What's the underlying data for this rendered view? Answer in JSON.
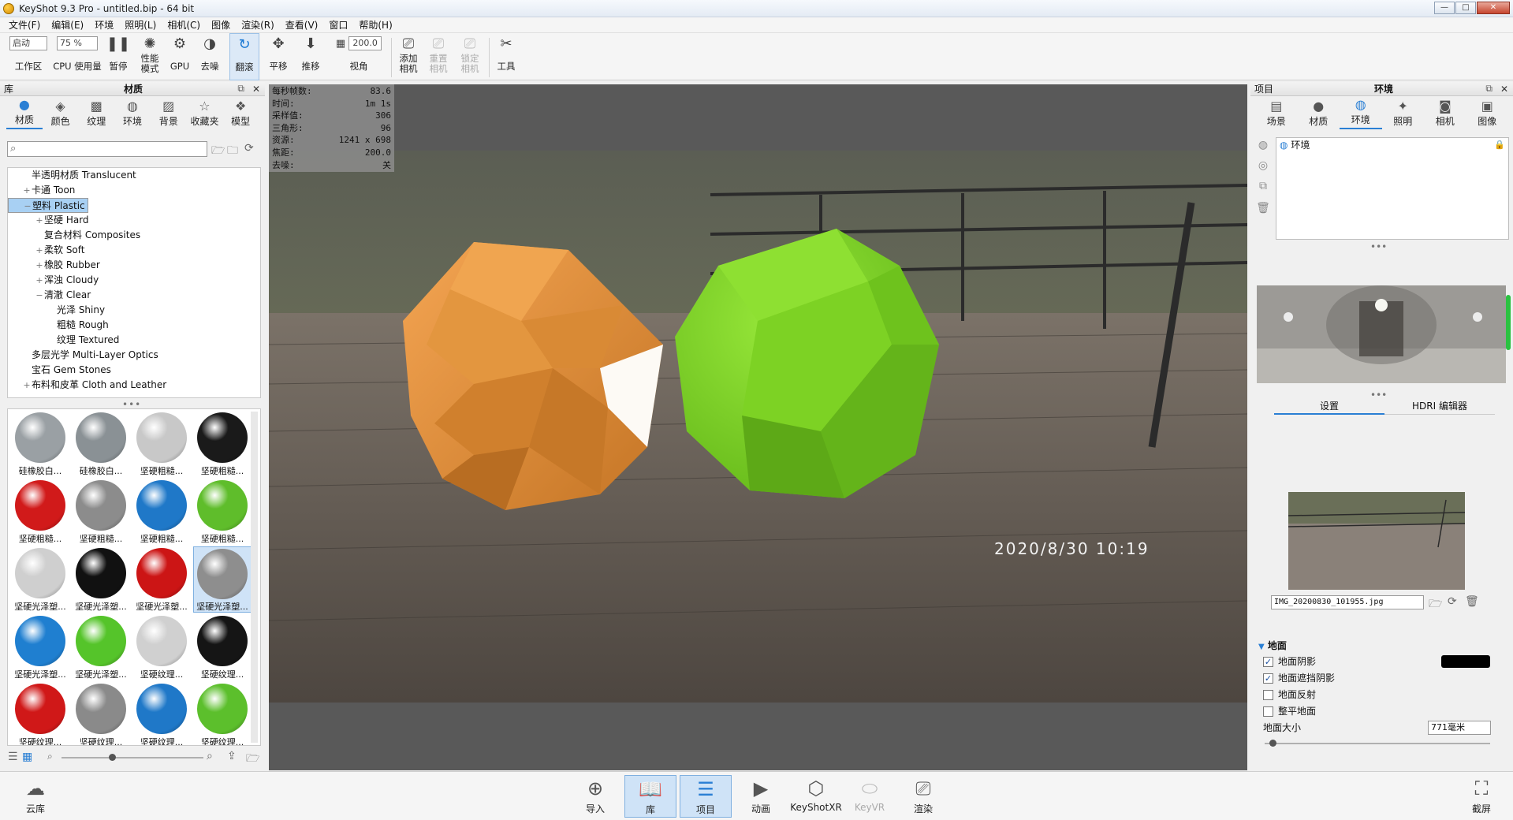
{
  "window": {
    "title": "KeyShot 9.3 Pro  - untitled.bip  - 64 bit",
    "min": "—",
    "max": "□",
    "close": "✕"
  },
  "menu": [
    "文件(F)",
    "编辑(E)",
    "环境",
    "照明(L)",
    "相机(C)",
    "图像",
    "渲染(R)",
    "查看(V)",
    "窗口",
    "帮助(H)"
  ],
  "toolbar": {
    "workspace_select": "启动",
    "workspace_label": "工作区",
    "cpu_select": "75 %",
    "cpu_label": "CPU 使用量",
    "pause_label": "暂停",
    "perf_label1": "性能",
    "perf_label2": "模式",
    "gpu_label": "GPU",
    "denoise_label": "去噪",
    "tumble_label": "翻滚",
    "pan_label": "平移",
    "dolly_label": "推移",
    "fov_value": "200.0",
    "fov_label": "视角",
    "add_cam_label1": "添加",
    "add_cam_label2": "相机",
    "reset_cam_label1": "重置",
    "reset_cam_label2": "相机",
    "lock_cam_label1": "锁定",
    "lock_cam_label2": "相机",
    "tools_label": "工具"
  },
  "library": {
    "header_left": "库",
    "header_title": "材质",
    "tabs": [
      {
        "icon": "material-icon",
        "label": "材质"
      },
      {
        "icon": "color-icon",
        "label": "颜色"
      },
      {
        "icon": "texture-icon",
        "label": "纹理"
      },
      {
        "icon": "environment-icon",
        "label": "环境"
      },
      {
        "icon": "background-icon",
        "label": "背景"
      },
      {
        "icon": "favorites-icon",
        "label": "收藏夹"
      },
      {
        "icon": "model-icon",
        "label": "模型"
      }
    ],
    "search_placeholder": "",
    "tree": [
      {
        "indent": 0,
        "exp": "",
        "label": "半透明材质 Translucent",
        "selected": false
      },
      {
        "indent": 0,
        "exp": "+",
        "label": "卡通 Toon",
        "selected": false
      },
      {
        "indent": 0,
        "exp": "−",
        "label": "塑料 Plastic",
        "selected": true
      },
      {
        "indent": 1,
        "exp": "+",
        "label": "坚硬 Hard",
        "selected": false
      },
      {
        "indent": 1,
        "exp": "",
        "label": "复合材料 Composites",
        "selected": false
      },
      {
        "indent": 1,
        "exp": "+",
        "label": "柔软 Soft",
        "selected": false
      },
      {
        "indent": 1,
        "exp": "+",
        "label": "橡胶 Rubber",
        "selected": false
      },
      {
        "indent": 1,
        "exp": "+",
        "label": "浑浊 Cloudy",
        "selected": false
      },
      {
        "indent": 1,
        "exp": "−",
        "label": "清澈 Clear",
        "selected": false
      },
      {
        "indent": 2,
        "exp": "",
        "label": "光泽 Shiny",
        "selected": false
      },
      {
        "indent": 2,
        "exp": "",
        "label": "粗糙 Rough",
        "selected": false
      },
      {
        "indent": 2,
        "exp": "",
        "label": "纹理 Textured",
        "selected": false
      },
      {
        "indent": 0,
        "exp": "",
        "label": "多层光学 Multi-Layer Optics",
        "selected": false
      },
      {
        "indent": 0,
        "exp": "",
        "label": "宝石 Gem Stones",
        "selected": false
      },
      {
        "indent": 0,
        "exp": "+",
        "label": "布料和皮革 Cloth and Leather",
        "selected": false
      }
    ],
    "thumbs": [
      {
        "label": "硅橡胶白...",
        "color": "#9aa0a4",
        "selected": false
      },
      {
        "label": "硅橡胶白...",
        "color": "#8a9195",
        "selected": false
      },
      {
        "label": "坚硬粗糙...",
        "color": "#c8c8c8",
        "selected": false
      },
      {
        "label": "坚硬粗糙...",
        "color": "#1a1a1a",
        "selected": false
      },
      {
        "label": "坚硬粗糙...",
        "color": "#d11a1a",
        "selected": false
      },
      {
        "label": "坚硬粗糙...",
        "color": "#8c8c8c",
        "selected": false
      },
      {
        "label": "坚硬粗糙...",
        "color": "#1f78c8",
        "selected": false
      },
      {
        "label": "坚硬粗糙...",
        "color": "#5fbd2b",
        "selected": false
      },
      {
        "label": "坚硬光泽塑...",
        "color": "#cfcfcf",
        "selected": false
      },
      {
        "label": "坚硬光泽塑...",
        "color": "#111111",
        "selected": false
      },
      {
        "label": "坚硬光泽塑...",
        "color": "#cc1515",
        "selected": false
      },
      {
        "label": "坚硬光泽塑...",
        "color": "#8e8e8e",
        "selected": true
      },
      {
        "label": "坚硬光泽塑...",
        "color": "#1f7fd0",
        "selected": false
      },
      {
        "label": "坚硬光泽塑...",
        "color": "#55c42a",
        "selected": false
      },
      {
        "label": "坚硬纹理...",
        "color": "#d0d0d0",
        "selected": false
      },
      {
        "label": "坚硬纹理...",
        "color": "#151515",
        "selected": false
      },
      {
        "label": "坚硬纹理...",
        "color": "#d01818",
        "selected": false
      },
      {
        "label": "坚硬纹理...",
        "color": "#8a8a8a",
        "selected": false
      },
      {
        "label": "坚硬纹理...",
        "color": "#1f78c8",
        "selected": false
      },
      {
        "label": "坚硬纹理...",
        "color": "#5cbf2c",
        "selected": false
      }
    ]
  },
  "hud": {
    "rows": [
      {
        "k": "每秒帧数:",
        "v": "83.6"
      },
      {
        "k": "时间:",
        "v": "1m 1s"
      },
      {
        "k": "采样值:",
        "v": "306"
      },
      {
        "k": "三角形:",
        "v": "96"
      },
      {
        "k": "资源:",
        "v": "1241 x 698"
      },
      {
        "k": "焦距:",
        "v": "200.0"
      },
      {
        "k": "去噪:",
        "v": "关"
      }
    ]
  },
  "scene": {
    "timestamp": "2020/8/30  10:19"
  },
  "project": {
    "header_left": "项目",
    "header_title": "环境",
    "tabs": [
      {
        "icon": "scene-icon",
        "label": "场景"
      },
      {
        "icon": "material-icon",
        "label": "材质"
      },
      {
        "icon": "environment-icon",
        "label": "环境"
      },
      {
        "icon": "lighting-icon",
        "label": "照明"
      },
      {
        "icon": "camera-icon",
        "label": "相机"
      },
      {
        "icon": "image-icon",
        "label": "图像"
      }
    ],
    "env_list_item": "环境",
    "subtabs": [
      "设置",
      "HDRI 编辑器"
    ],
    "bg_file": "IMG_20200830_101955.jpg",
    "ground_section": "地面",
    "ground_shadow": "地面阴影",
    "ground_occlusion": "地面遮挡阴影",
    "ground_reflection": "地面反射",
    "flatten_ground": "整平地面",
    "ground_size_label": "地面大小",
    "ground_size_value": "771毫米",
    "ground_slider": 0.02
  },
  "footer": {
    "cloud_label": "云库",
    "import_label": "导入",
    "library_label": "库",
    "project_label": "项目",
    "animation_label": "动画",
    "keyshotxr_label": "KeyShotXR",
    "keyvr_label": "KeyVR",
    "render_label": "渲染",
    "screenshot_label": "截屏"
  },
  "colors": {
    "accent": "#2a7fd4",
    "orange_model": "#e8953f",
    "green_model": "#7ed321"
  }
}
